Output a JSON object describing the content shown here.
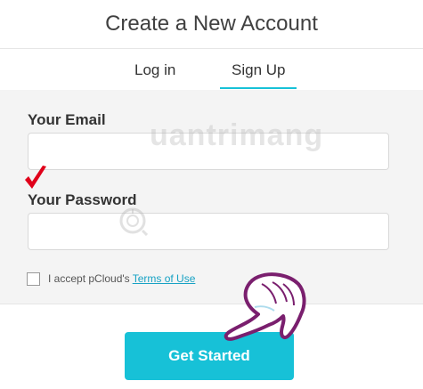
{
  "header": {
    "title": "Create a New Account"
  },
  "tabs": [
    {
      "label": "Log in"
    },
    {
      "label": "Sign Up",
      "active": true
    }
  ],
  "form": {
    "email_label": "Your Email",
    "email_value": "",
    "password_label": "Your Password",
    "password_value": "",
    "terms_text": "I accept pCloud's",
    "terms_link": "Terms of Use",
    "terms_checked": false
  },
  "watermark": {
    "text": "uantrimang"
  },
  "submit": {
    "label": "Get Started"
  },
  "colors": {
    "accent": "#17c1d7",
    "link": "#17a2c4",
    "annotation_check": "#e0001a",
    "annotation_hand": "#7a1f6e"
  }
}
